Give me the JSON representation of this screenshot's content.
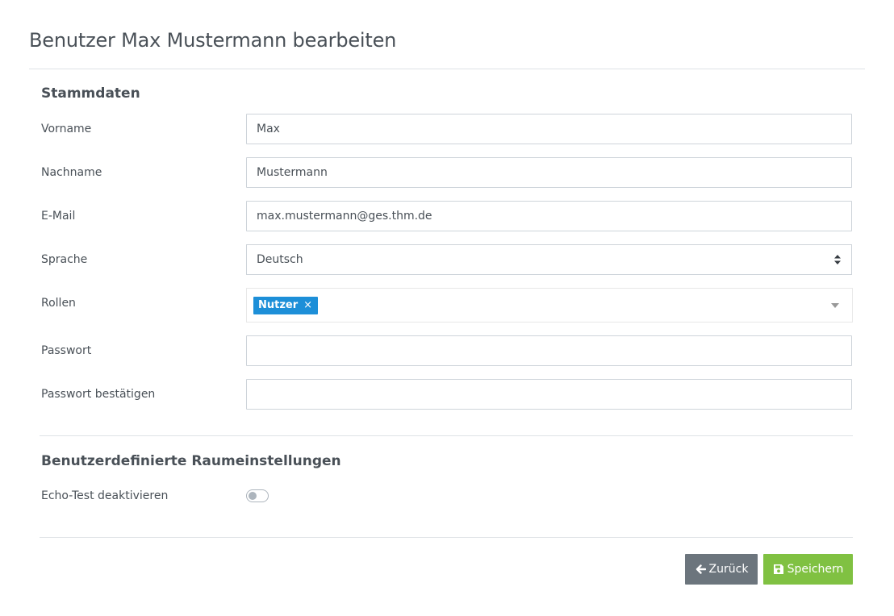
{
  "page": {
    "title": "Benutzer Max Mustermann bearbeiten"
  },
  "stammdaten": {
    "heading": "Stammdaten",
    "firstname": {
      "label": "Vorname",
      "value": "Max"
    },
    "lastname": {
      "label": "Nachname",
      "value": "Mustermann"
    },
    "email": {
      "label": "E-Mail",
      "value": "max.mustermann@ges.thm.de"
    },
    "language": {
      "label": "Sprache",
      "value": "Deutsch"
    },
    "roles": {
      "label": "Rollen",
      "tags": [
        "Nutzer"
      ],
      "remove_glyph": "×"
    },
    "password": {
      "label": "Passwort",
      "value": ""
    },
    "password_confirm": {
      "label": "Passwort bestätigen",
      "value": ""
    }
  },
  "room_settings": {
    "heading": "Benutzerdefinierte Raumeinstellungen",
    "echo_test": {
      "label": "Echo-Test deaktivieren",
      "enabled": false
    }
  },
  "actions": {
    "back_label": "Zurück",
    "back_icon": "arrow-left-icon",
    "save_label": "Speichern",
    "save_icon": "floppy-disk-icon"
  },
  "colors": {
    "tag": "#1d8fd8",
    "back_button": "#6c757d",
    "save_button": "#80c142"
  }
}
